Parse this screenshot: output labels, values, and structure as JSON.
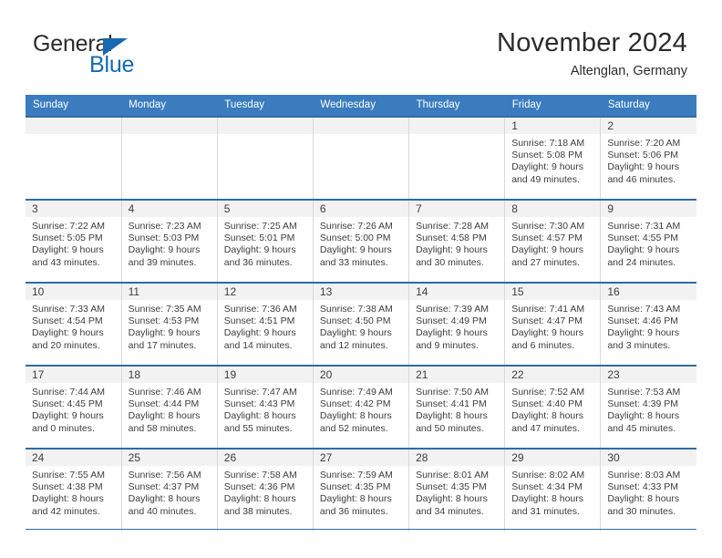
{
  "brand": {
    "name_primary": "General",
    "name_secondary": "Blue",
    "primary_color": "#2b2b2b",
    "accent_color": "#1769b0"
  },
  "header": {
    "month_title": "November 2024",
    "location": "Altenglan, Germany",
    "header_bg_color": "#3a7cbe",
    "row_border_color": "#2e6ca4"
  },
  "weekdays": [
    {
      "label": "Sunday"
    },
    {
      "label": "Monday"
    },
    {
      "label": "Tuesday"
    },
    {
      "label": "Wednesday"
    },
    {
      "label": "Thursday"
    },
    {
      "label": "Friday"
    },
    {
      "label": "Saturday"
    }
  ],
  "weeks": [
    [
      {
        "day": "",
        "sunrise": "",
        "sunset": "",
        "daylight_1": "",
        "daylight_2": ""
      },
      {
        "day": "",
        "sunrise": "",
        "sunset": "",
        "daylight_1": "",
        "daylight_2": ""
      },
      {
        "day": "",
        "sunrise": "",
        "sunset": "",
        "daylight_1": "",
        "daylight_2": ""
      },
      {
        "day": "",
        "sunrise": "",
        "sunset": "",
        "daylight_1": "",
        "daylight_2": ""
      },
      {
        "day": "",
        "sunrise": "",
        "sunset": "",
        "daylight_1": "",
        "daylight_2": ""
      },
      {
        "day": "1",
        "sunrise": "Sunrise: 7:18 AM",
        "sunset": "Sunset: 5:08 PM",
        "daylight_1": "Daylight: 9 hours",
        "daylight_2": "and 49 minutes."
      },
      {
        "day": "2",
        "sunrise": "Sunrise: 7:20 AM",
        "sunset": "Sunset: 5:06 PM",
        "daylight_1": "Daylight: 9 hours",
        "daylight_2": "and 46 minutes."
      }
    ],
    [
      {
        "day": "3",
        "sunrise": "Sunrise: 7:22 AM",
        "sunset": "Sunset: 5:05 PM",
        "daylight_1": "Daylight: 9 hours",
        "daylight_2": "and 43 minutes."
      },
      {
        "day": "4",
        "sunrise": "Sunrise: 7:23 AM",
        "sunset": "Sunset: 5:03 PM",
        "daylight_1": "Daylight: 9 hours",
        "daylight_2": "and 39 minutes."
      },
      {
        "day": "5",
        "sunrise": "Sunrise: 7:25 AM",
        "sunset": "Sunset: 5:01 PM",
        "daylight_1": "Daylight: 9 hours",
        "daylight_2": "and 36 minutes."
      },
      {
        "day": "6",
        "sunrise": "Sunrise: 7:26 AM",
        "sunset": "Sunset: 5:00 PM",
        "daylight_1": "Daylight: 9 hours",
        "daylight_2": "and 33 minutes."
      },
      {
        "day": "7",
        "sunrise": "Sunrise: 7:28 AM",
        "sunset": "Sunset: 4:58 PM",
        "daylight_1": "Daylight: 9 hours",
        "daylight_2": "and 30 minutes."
      },
      {
        "day": "8",
        "sunrise": "Sunrise: 7:30 AM",
        "sunset": "Sunset: 4:57 PM",
        "daylight_1": "Daylight: 9 hours",
        "daylight_2": "and 27 minutes."
      },
      {
        "day": "9",
        "sunrise": "Sunrise: 7:31 AM",
        "sunset": "Sunset: 4:55 PM",
        "daylight_1": "Daylight: 9 hours",
        "daylight_2": "and 24 minutes."
      }
    ],
    [
      {
        "day": "10",
        "sunrise": "Sunrise: 7:33 AM",
        "sunset": "Sunset: 4:54 PM",
        "daylight_1": "Daylight: 9 hours",
        "daylight_2": "and 20 minutes."
      },
      {
        "day": "11",
        "sunrise": "Sunrise: 7:35 AM",
        "sunset": "Sunset: 4:53 PM",
        "daylight_1": "Daylight: 9 hours",
        "daylight_2": "and 17 minutes."
      },
      {
        "day": "12",
        "sunrise": "Sunrise: 7:36 AM",
        "sunset": "Sunset: 4:51 PM",
        "daylight_1": "Daylight: 9 hours",
        "daylight_2": "and 14 minutes."
      },
      {
        "day": "13",
        "sunrise": "Sunrise: 7:38 AM",
        "sunset": "Sunset: 4:50 PM",
        "daylight_1": "Daylight: 9 hours",
        "daylight_2": "and 12 minutes."
      },
      {
        "day": "14",
        "sunrise": "Sunrise: 7:39 AM",
        "sunset": "Sunset: 4:49 PM",
        "daylight_1": "Daylight: 9 hours",
        "daylight_2": "and 9 minutes."
      },
      {
        "day": "15",
        "sunrise": "Sunrise: 7:41 AM",
        "sunset": "Sunset: 4:47 PM",
        "daylight_1": "Daylight: 9 hours",
        "daylight_2": "and 6 minutes."
      },
      {
        "day": "16",
        "sunrise": "Sunrise: 7:43 AM",
        "sunset": "Sunset: 4:46 PM",
        "daylight_1": "Daylight: 9 hours",
        "daylight_2": "and 3 minutes."
      }
    ],
    [
      {
        "day": "17",
        "sunrise": "Sunrise: 7:44 AM",
        "sunset": "Sunset: 4:45 PM",
        "daylight_1": "Daylight: 9 hours",
        "daylight_2": "and 0 minutes."
      },
      {
        "day": "18",
        "sunrise": "Sunrise: 7:46 AM",
        "sunset": "Sunset: 4:44 PM",
        "daylight_1": "Daylight: 8 hours",
        "daylight_2": "and 58 minutes."
      },
      {
        "day": "19",
        "sunrise": "Sunrise: 7:47 AM",
        "sunset": "Sunset: 4:43 PM",
        "daylight_1": "Daylight: 8 hours",
        "daylight_2": "and 55 minutes."
      },
      {
        "day": "20",
        "sunrise": "Sunrise: 7:49 AM",
        "sunset": "Sunset: 4:42 PM",
        "daylight_1": "Daylight: 8 hours",
        "daylight_2": "and 52 minutes."
      },
      {
        "day": "21",
        "sunrise": "Sunrise: 7:50 AM",
        "sunset": "Sunset: 4:41 PM",
        "daylight_1": "Daylight: 8 hours",
        "daylight_2": "and 50 minutes."
      },
      {
        "day": "22",
        "sunrise": "Sunrise: 7:52 AM",
        "sunset": "Sunset: 4:40 PM",
        "daylight_1": "Daylight: 8 hours",
        "daylight_2": "and 47 minutes."
      },
      {
        "day": "23",
        "sunrise": "Sunrise: 7:53 AM",
        "sunset": "Sunset: 4:39 PM",
        "daylight_1": "Daylight: 8 hours",
        "daylight_2": "and 45 minutes."
      }
    ],
    [
      {
        "day": "24",
        "sunrise": "Sunrise: 7:55 AM",
        "sunset": "Sunset: 4:38 PM",
        "daylight_1": "Daylight: 8 hours",
        "daylight_2": "and 42 minutes."
      },
      {
        "day": "25",
        "sunrise": "Sunrise: 7:56 AM",
        "sunset": "Sunset: 4:37 PM",
        "daylight_1": "Daylight: 8 hours",
        "daylight_2": "and 40 minutes."
      },
      {
        "day": "26",
        "sunrise": "Sunrise: 7:58 AM",
        "sunset": "Sunset: 4:36 PM",
        "daylight_1": "Daylight: 8 hours",
        "daylight_2": "and 38 minutes."
      },
      {
        "day": "27",
        "sunrise": "Sunrise: 7:59 AM",
        "sunset": "Sunset: 4:35 PM",
        "daylight_1": "Daylight: 8 hours",
        "daylight_2": "and 36 minutes."
      },
      {
        "day": "28",
        "sunrise": "Sunrise: 8:01 AM",
        "sunset": "Sunset: 4:35 PM",
        "daylight_1": "Daylight: 8 hours",
        "daylight_2": "and 34 minutes."
      },
      {
        "day": "29",
        "sunrise": "Sunrise: 8:02 AM",
        "sunset": "Sunset: 4:34 PM",
        "daylight_1": "Daylight: 8 hours",
        "daylight_2": "and 31 minutes."
      },
      {
        "day": "30",
        "sunrise": "Sunrise: 8:03 AM",
        "sunset": "Sunset: 4:33 PM",
        "daylight_1": "Daylight: 8 hours",
        "daylight_2": "and 30 minutes."
      }
    ]
  ]
}
